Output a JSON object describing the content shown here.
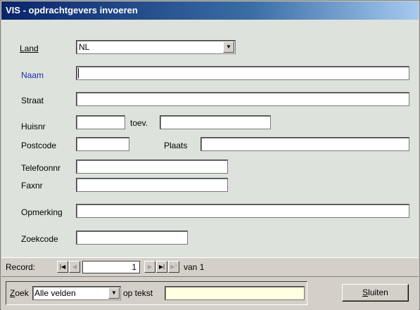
{
  "window": {
    "title": "VIS - opdrachtgevers invoeren"
  },
  "form": {
    "land": {
      "label": "Land",
      "value": "NL"
    },
    "naam": {
      "label": "Naam",
      "value": ""
    },
    "straat": {
      "label": "Straat",
      "value": ""
    },
    "huisnr": {
      "label": "Huisnr",
      "value": ""
    },
    "toev": {
      "label": "toev.",
      "value": ""
    },
    "postcode": {
      "label": "Postcode",
      "value": ""
    },
    "plaats": {
      "label": "Plaats",
      "value": ""
    },
    "telefoonnr": {
      "label": "Telefoonnr",
      "value": ""
    },
    "faxnr": {
      "label": "Faxnr",
      "value": ""
    },
    "opmerking": {
      "label": "Opmerking",
      "value": ""
    },
    "zoekcode": {
      "label": "Zoekcode",
      "value": ""
    }
  },
  "record_nav": {
    "label": "Record:",
    "current": "1",
    "of_label": "van",
    "total": "1",
    "icons": [
      "first-record-icon",
      "previous-record-icon",
      "next-record-icon",
      "last-record-icon",
      "new-record-icon"
    ]
  },
  "search": {
    "zoek_label": "Zoek",
    "field_value": "Alle velden",
    "op_tekst_label": "op tekst",
    "text_value": ""
  },
  "buttons": {
    "sluiten": "Sluiten"
  },
  "colors": {
    "title_start": "#0a246a",
    "title_end": "#a6caf0",
    "form_bg": "#dde3dc",
    "naam_label": "#1d2bac",
    "search_input_bg": "#ffffe1"
  }
}
